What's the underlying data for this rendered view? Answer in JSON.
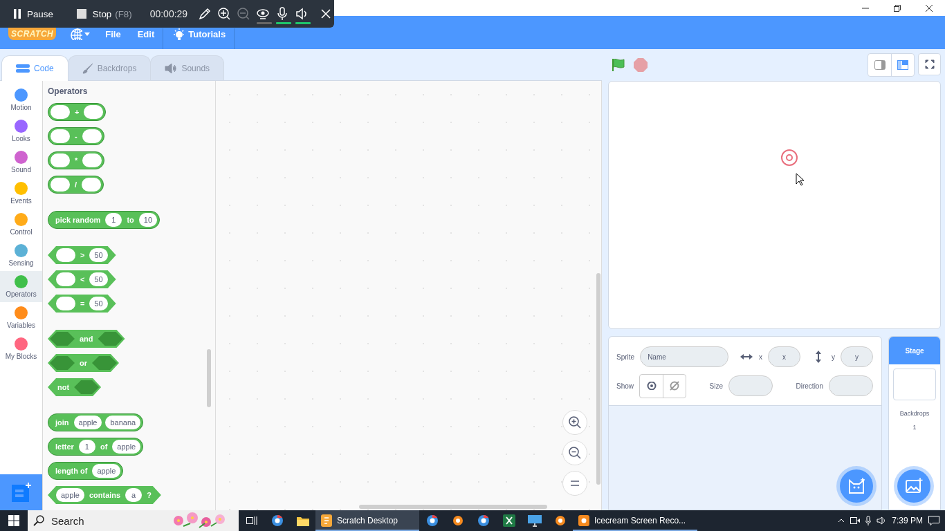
{
  "recorder_toolbar": {
    "pause_label": "Pause",
    "stop_label": "Stop",
    "stop_shortcut": "(F8)",
    "timer": "00:00:29",
    "zoom_out_disabled": true,
    "webcam_on": false,
    "microphone_on": true,
    "speaker_on": true
  },
  "menu_bar": {
    "logo": "SCRATCH",
    "items": [
      "File",
      "Edit"
    ],
    "tutorials": "Tutorials"
  },
  "tabs": [
    {
      "label": "Code",
      "selected": true,
      "kind": "code"
    },
    {
      "label": "Backdrops",
      "selected": false,
      "kind": "paint"
    },
    {
      "label": "Sounds",
      "selected": false,
      "kind": "sound"
    }
  ],
  "categories": [
    {
      "label": "Motion",
      "color": "#4c97ff",
      "selected": false
    },
    {
      "label": "Looks",
      "color": "#9966ff",
      "selected": false
    },
    {
      "label": "Sound",
      "color": "#cf63cf",
      "selected": false
    },
    {
      "label": "Events",
      "color": "#ffbf00",
      "selected": false
    },
    {
      "label": "Control",
      "color": "#ffab19",
      "selected": false
    },
    {
      "label": "Sensing",
      "color": "#5cb1d6",
      "selected": false
    },
    {
      "label": "Operators",
      "color": "#40bf4a",
      "selected": true
    },
    {
      "label": "Variables",
      "color": "#ff8c1a",
      "selected": false
    },
    {
      "label": "My Blocks",
      "color": "#ff6680",
      "selected": false
    }
  ],
  "palette": {
    "title": "Operators",
    "groups": [
      [
        {
          "kind": "reporter",
          "parts": [
            {
              "kind": "slot"
            },
            {
              "kind": "label",
              "text": "+"
            },
            {
              "kind": "slot"
            }
          ]
        },
        {
          "kind": "reporter",
          "parts": [
            {
              "kind": "slot"
            },
            {
              "kind": "label",
              "text": "-"
            },
            {
              "kind": "slot"
            }
          ]
        },
        {
          "kind": "reporter",
          "parts": [
            {
              "kind": "slot"
            },
            {
              "kind": "label",
              "text": "*"
            },
            {
              "kind": "slot"
            }
          ]
        },
        {
          "kind": "reporter",
          "parts": [
            {
              "kind": "slot"
            },
            {
              "kind": "label",
              "text": "/"
            },
            {
              "kind": "slot"
            }
          ]
        }
      ],
      [
        {
          "kind": "reporter",
          "parts": [
            {
              "kind": "label",
              "text": "pick random"
            },
            {
              "kind": "slot",
              "text": "1"
            },
            {
              "kind": "label",
              "text": "to"
            },
            {
              "kind": "slot",
              "text": "10"
            }
          ]
        }
      ],
      [
        {
          "kind": "boolean",
          "parts": [
            {
              "kind": "slot"
            },
            {
              "kind": "label",
              "text": ">"
            },
            {
              "kind": "slot",
              "text": "50"
            }
          ]
        },
        {
          "kind": "boolean",
          "parts": [
            {
              "kind": "slot"
            },
            {
              "kind": "label",
              "text": "<"
            },
            {
              "kind": "slot",
              "text": "50"
            }
          ]
        },
        {
          "kind": "boolean",
          "parts": [
            {
              "kind": "slot"
            },
            {
              "kind": "label",
              "text": "="
            },
            {
              "kind": "slot",
              "text": "50"
            }
          ]
        }
      ],
      [
        {
          "kind": "boolean",
          "parts": [
            {
              "kind": "bool_slot"
            },
            {
              "kind": "label",
              "text": "and"
            },
            {
              "kind": "bool_slot"
            }
          ]
        },
        {
          "kind": "boolean",
          "parts": [
            {
              "kind": "bool_slot"
            },
            {
              "kind": "label",
              "text": "or"
            },
            {
              "kind": "bool_slot"
            }
          ]
        },
        {
          "kind": "boolean",
          "parts": [
            {
              "kind": "label",
              "text": "not"
            },
            {
              "kind": "bool_slot"
            }
          ]
        }
      ],
      [
        {
          "kind": "reporter",
          "parts": [
            {
              "kind": "label",
              "text": "join"
            },
            {
              "kind": "slot",
              "text": "apple"
            },
            {
              "kind": "slot",
              "text": "banana"
            }
          ]
        },
        {
          "kind": "reporter",
          "parts": [
            {
              "kind": "label",
              "text": "letter"
            },
            {
              "kind": "slot",
              "text": "1"
            },
            {
              "kind": "label",
              "text": "of"
            },
            {
              "kind": "slot",
              "text": "apple"
            }
          ]
        },
        {
          "kind": "reporter",
          "parts": [
            {
              "kind": "label",
              "text": "length of"
            },
            {
              "kind": "slot",
              "text": "apple"
            }
          ]
        },
        {
          "kind": "boolean",
          "parts": [
            {
              "kind": "slot",
              "text": "apple"
            },
            {
              "kind": "label",
              "text": "contains"
            },
            {
              "kind": "slot",
              "text": "a"
            },
            {
              "kind": "label",
              "text": "?"
            }
          ]
        }
      ]
    ]
  },
  "sprite_info": {
    "sprite_label": "Sprite",
    "name_placeholder": "Name",
    "x_label": "x",
    "x_placeholder": "x",
    "y_label": "y",
    "y_placeholder": "y",
    "show_label": "Show",
    "size_label": "Size",
    "direction_label": "Direction"
  },
  "stage_selector": {
    "title": "Stage",
    "backdrops_label": "Backdrops",
    "backdrops_count": "1"
  },
  "taskbar": {
    "search_placeholder": "Search",
    "apps": [
      {
        "kind": "taskview",
        "selected": false
      },
      {
        "kind": "browser",
        "selected": false
      },
      {
        "kind": "folder",
        "selected": false
      },
      {
        "kind": "scratch",
        "label": "Scratch Desktop",
        "selected": true
      },
      {
        "kind": "browser",
        "selected": false
      },
      {
        "kind": "app",
        "selected": false
      },
      {
        "kind": "browser",
        "selected": false
      },
      {
        "kind": "spreadsheet",
        "selected": false
      },
      {
        "kind": "monitor",
        "selected": false
      },
      {
        "kind": "app",
        "selected": false
      },
      {
        "kind": "recorder",
        "label": "Icecream Screen Reco...",
        "selected": false
      }
    ],
    "clock": "7:39 PM"
  }
}
